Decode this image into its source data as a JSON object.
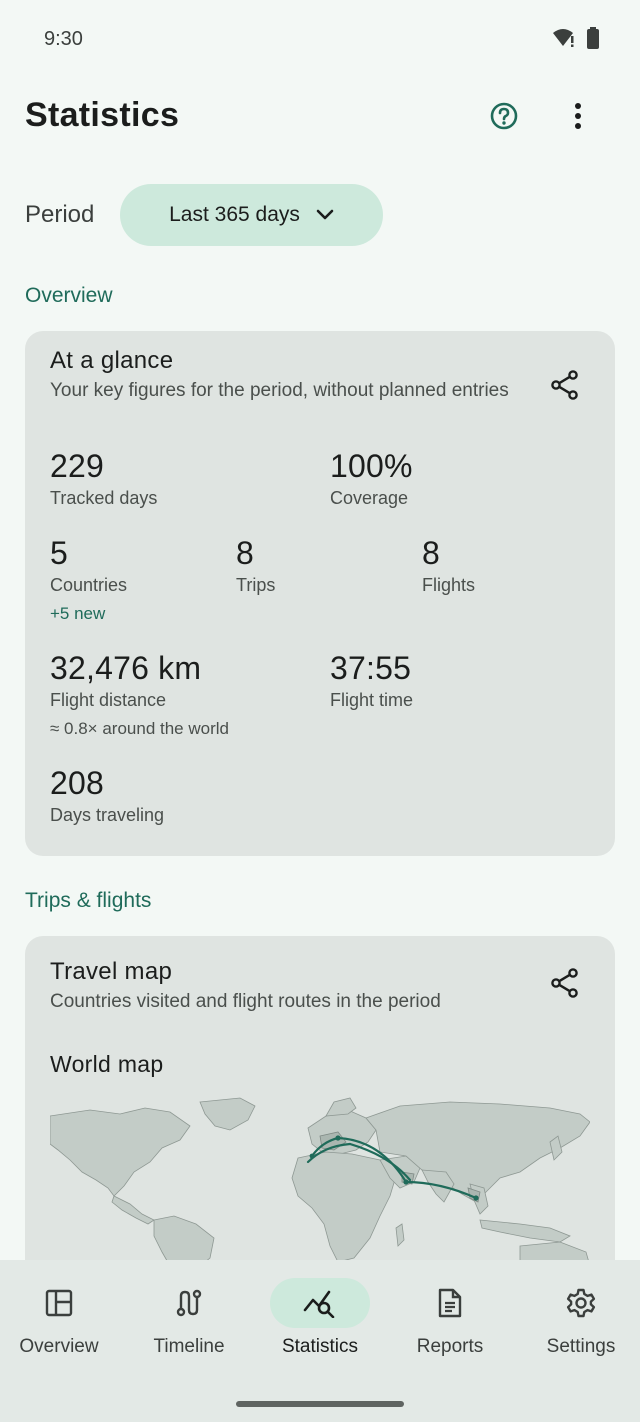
{
  "status_bar": {
    "time": "9:30",
    "icons": [
      "wifi-alert-icon",
      "battery-icon"
    ]
  },
  "top_bar": {
    "title": "Statistics",
    "help_icon": "help-circle-icon",
    "more_icon": "more-vert-icon"
  },
  "period": {
    "label": "Period",
    "selected": "Last 365 days"
  },
  "sections": {
    "overview": "Overview",
    "trips_flights": "Trips & flights"
  },
  "glance_card": {
    "title": "At a glance",
    "subtitle": "Your key figures for the period, without planned entries",
    "stats": {
      "tracked_days": {
        "value": "229",
        "label": "Tracked days"
      },
      "coverage": {
        "value": "100%",
        "label": "Coverage"
      },
      "countries": {
        "value": "5",
        "label": "Countries",
        "extra": "+5 new"
      },
      "trips": {
        "value": "8",
        "label": "Trips"
      },
      "flights": {
        "value": "8",
        "label": "Flights"
      },
      "flight_distance": {
        "value": "32,476 km",
        "label": "Flight distance",
        "extra": "≈ 0.8× around the world"
      },
      "flight_time": {
        "value": "37:55",
        "label": "Flight time"
      },
      "days_traveling": {
        "value": "208",
        "label": "Days traveling"
      }
    }
  },
  "map_card": {
    "title": "Travel map",
    "subtitle": "Countries visited and flight routes in the period",
    "map_title": "World map"
  },
  "bottom_nav": {
    "items": [
      {
        "label": "Overview",
        "icon": "dashboard-icon"
      },
      {
        "label": "Timeline",
        "icon": "route-icon"
      },
      {
        "label": "Statistics",
        "icon": "query-stats-icon",
        "active": true
      },
      {
        "label": "Reports",
        "icon": "document-icon"
      },
      {
        "label": "Settings",
        "icon": "gear-icon"
      }
    ]
  },
  "colors": {
    "accent": "#1f6b5a",
    "chip": "#cde9dc",
    "card": "#dfe4e1",
    "background": "#f3f8f5"
  }
}
